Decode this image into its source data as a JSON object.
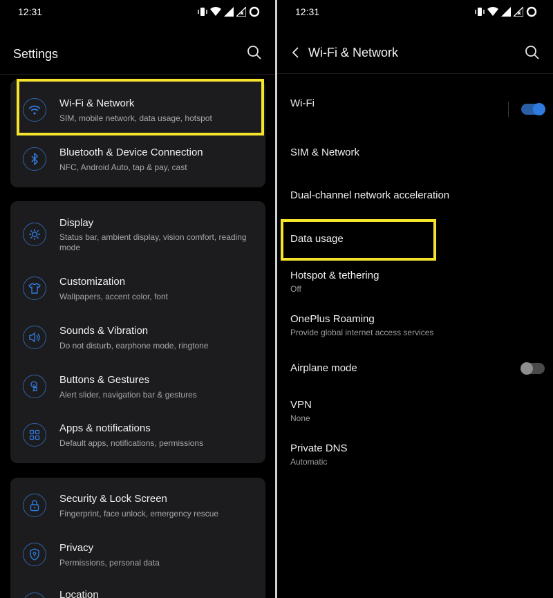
{
  "colors": {
    "accent": "#2f7be0",
    "highlight": "#f5e32c",
    "card": "#1c1c1e",
    "background": "#000000"
  },
  "left": {
    "status_time": "12:31",
    "status_icons": [
      "vibrate-icon",
      "wifi-icon",
      "signal-icon",
      "signal-no-data-icon",
      "battery-icon"
    ],
    "title": "Settings",
    "cards": [
      {
        "items": [
          {
            "icon": "wifi-icon",
            "title": "Wi-Fi & Network",
            "subtitle": "SIM, mobile network, data usage, hotspot",
            "highlighted": true
          },
          {
            "icon": "bluetooth-icon",
            "title": "Bluetooth & Device Connection",
            "subtitle": "NFC, Android Auto, tap & pay, cast"
          }
        ]
      },
      {
        "items": [
          {
            "icon": "brightness-icon",
            "title": "Display",
            "subtitle": "Status bar, ambient display, vision comfort, reading mode"
          },
          {
            "icon": "tshirt-icon",
            "title": "Customization",
            "subtitle": "Wallpapers, accent color, font"
          },
          {
            "icon": "speaker-icon",
            "title": "Sounds & Vibration",
            "subtitle": "Do not disturb, earphone mode, ringtone"
          },
          {
            "icon": "gesture-icon",
            "title": "Buttons & Gestures",
            "subtitle": "Alert slider, navigation bar & gestures"
          },
          {
            "icon": "apps-grid-icon",
            "title": "Apps & notifications",
            "subtitle": "Default apps, notifications, permissions"
          }
        ]
      },
      {
        "items": [
          {
            "icon": "lock-icon",
            "title": "Security & Lock Screen",
            "subtitle": "Fingerprint, face unlock, emergency rescue"
          },
          {
            "icon": "privacy-shield-icon",
            "title": "Privacy",
            "subtitle": "Permissions, personal data"
          },
          {
            "icon": "location-icon",
            "title": "Location",
            "subtitle": ""
          }
        ]
      }
    ]
  },
  "right": {
    "status_time": "12:31",
    "status_icons": [
      "vibrate-icon",
      "wifi-icon",
      "signal-icon",
      "signal-no-data-icon",
      "battery-icon"
    ],
    "title": "Wi-Fi & Network",
    "items": [
      {
        "title": "Wi-Fi",
        "subtitle": "",
        "toggle": true,
        "toggle_on": true
      },
      {
        "title": "SIM & Network",
        "subtitle": ""
      },
      {
        "title": "Dual-channel network acceleration",
        "subtitle": ""
      },
      {
        "title": "Data usage",
        "subtitle": "",
        "highlighted": true
      },
      {
        "title": "Hotspot & tethering",
        "subtitle": "Off"
      },
      {
        "title": "OnePlus Roaming",
        "subtitle": "Provide global internet access services"
      },
      {
        "title": "Airplane mode",
        "subtitle": "",
        "toggle": true,
        "toggle_on": false
      },
      {
        "title": "VPN",
        "subtitle": "None"
      },
      {
        "title": "Private DNS",
        "subtitle": "Automatic"
      }
    ]
  }
}
